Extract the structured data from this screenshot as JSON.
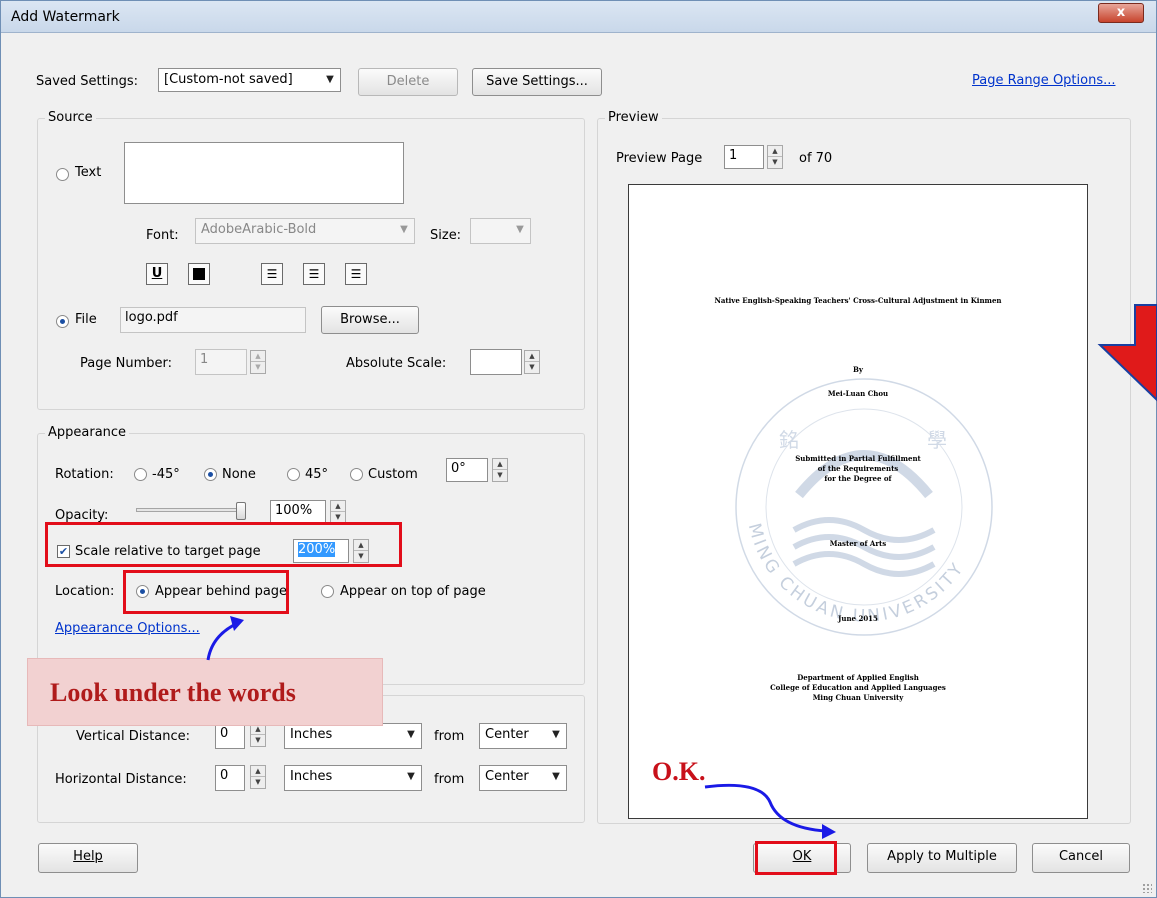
{
  "window": {
    "title": "Add Watermark",
    "close_label": "x"
  },
  "header": {
    "saved_settings_label": "Saved Settings:",
    "saved_settings_value": "[Custom-not saved]",
    "delete_label": "Delete",
    "save_settings_label": "Save Settings...",
    "page_range_link": "Page Range Options..."
  },
  "source": {
    "group_title": "Source",
    "text_radio_label": "Text",
    "text_value": "",
    "font_label": "Font:",
    "font_value": "AdobeArabic-Bold",
    "size_label": "Size:",
    "size_value": "",
    "underline_label": "U",
    "file_radio_label": "File",
    "file_value": "logo.pdf",
    "browse_label": "Browse...",
    "page_number_label": "Page Number:",
    "page_number_value": "1",
    "absolute_scale_label": "Absolute Scale:",
    "absolute_scale_value": ""
  },
  "appearance": {
    "group_title": "Appearance",
    "rotation_label": "Rotation:",
    "rot_neg45": "-45°",
    "rot_none": "None",
    "rot_45": "45°",
    "rot_custom": "Custom",
    "rot_custom_value": "0°",
    "opacity_label": "Opacity:",
    "opacity_value": "100%",
    "opacity_level": 1.0,
    "scale_label": "Scale relative to target page",
    "scale_value": "200%",
    "location_label": "Location:",
    "behind_label": "Appear behind page",
    "on_top_label": "Appear on top of page",
    "appearance_options_link": "Appearance Options..."
  },
  "position": {
    "vertical_label": "Vertical Distance:",
    "vertical_value": "0",
    "vertical_unit": "Inches",
    "vertical_from_label": "from",
    "vertical_from": "Center",
    "horizontal_label": "Horizontal Distance:",
    "horizontal_value": "0",
    "horizontal_unit": "Inches",
    "horizontal_from_label": "from",
    "horizontal_from": "Center"
  },
  "preview": {
    "group_title": "Preview",
    "preview_page_label": "Preview Page",
    "page_value": "1",
    "of_label": "of 70",
    "doc": {
      "title": "Native English-Speaking Teachers' Cross-Cultural Adjustment in Kinmen",
      "by": "By",
      "author": "Mei-Luan Chou",
      "submitted_1": "Submitted in Partial Fulfillment",
      "submitted_2": "of the Requirements",
      "submitted_3": "for the Degree of",
      "degree": "Master of Arts",
      "date": "June 2015",
      "dept": "Department of Applied English",
      "college": "College of Education and Applied Languages",
      "university": "Ming Chuan University",
      "watermark_text": "MING CHUAN UNIVERSITY"
    }
  },
  "footer": {
    "help_label": "Help",
    "ok_label": "OK",
    "apply_multiple_label": "Apply to Multiple",
    "cancel_label": "Cancel"
  },
  "annotations": {
    "callout": "Look under the words",
    "ok_note": "O.K.",
    "highlight_color": "#e20d1a",
    "arrow_color": "#1a1ae6"
  }
}
